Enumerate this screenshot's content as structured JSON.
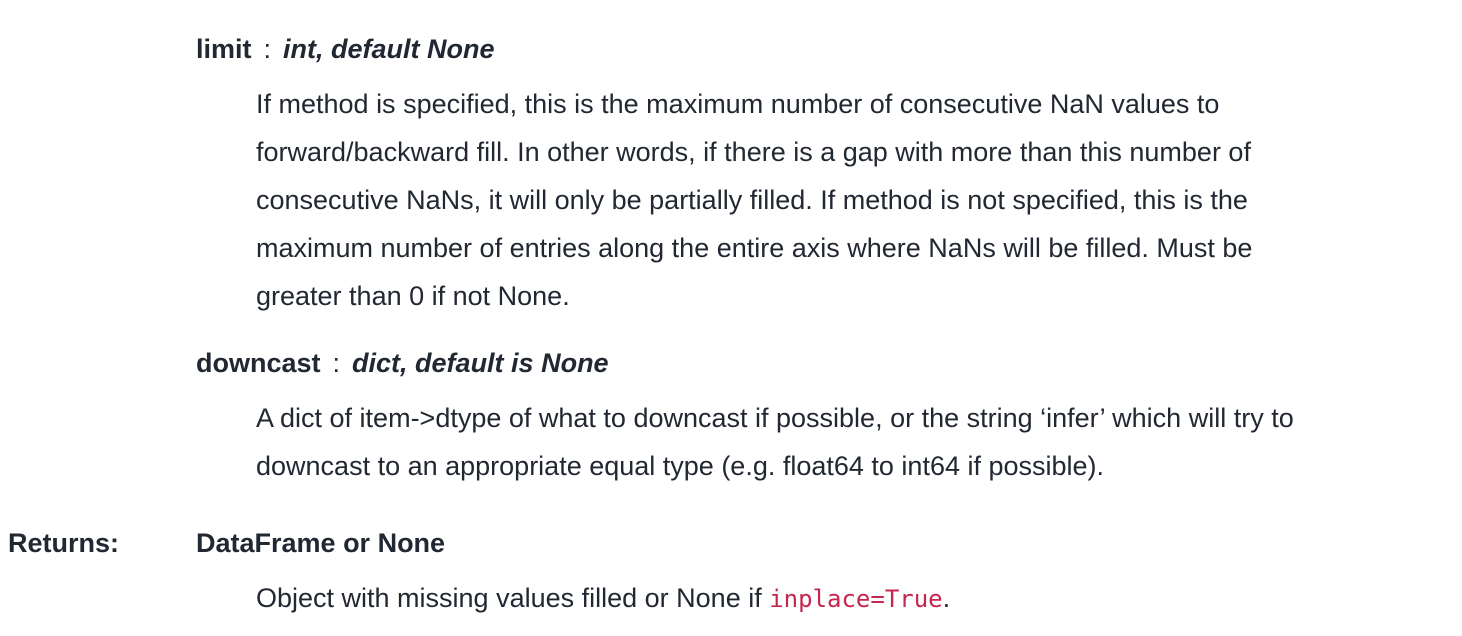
{
  "params": {
    "limit": {
      "name": "limit",
      "sep": ":",
      "type": "int, default None",
      "desc_lines": [
        "If method is specified, this is the maximum number of consecutive NaN values to",
        "forward/backward fill. In other words, if there is a gap with more than this number of",
        "consecutive NaNs, it will only be partially filled. If method is not specified, this is the",
        "maximum number of entries along the entire axis where NaNs will be filled. Must be",
        "greater than 0 if not None."
      ]
    },
    "downcast": {
      "name": "downcast",
      "sep": ":",
      "type": "dict, default is None",
      "desc_lines": [
        "A dict of item->dtype of what to downcast if possible, or the string ‘infer’ which will try to",
        "downcast to an appropriate equal type (e.g. float64 to int64 if possible)."
      ]
    }
  },
  "returns": {
    "label": "Returns:",
    "type": "DataFrame or None",
    "desc_prefix": "Object with missing values filled or None if ",
    "desc_code": "inplace=True",
    "desc_suffix": "."
  },
  "colors": {
    "text": "#222832",
    "code": "#c7254e"
  }
}
